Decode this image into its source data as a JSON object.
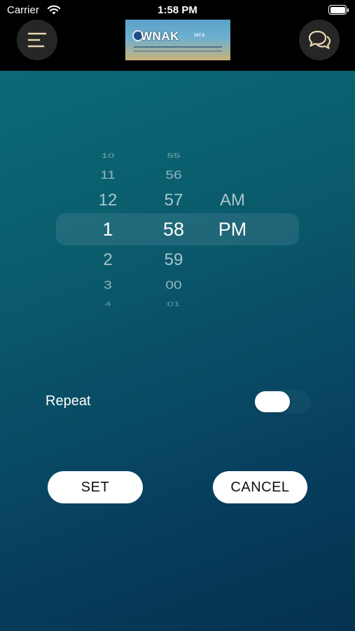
{
  "status_bar": {
    "carrier": "Carrier",
    "time": "1:58 PM"
  },
  "header": {
    "logo_text": "WNAK",
    "logo_sub": "107.5",
    "menu_icon": "menu-icon",
    "chat_icon": "chat-icon"
  },
  "picker": {
    "hours": [
      "10",
      "11",
      "12",
      "1",
      "2",
      "3",
      "4"
    ],
    "minutes": [
      "55",
      "56",
      "57",
      "58",
      "59",
      "00",
      "01"
    ],
    "periods": [
      "AM",
      "PM"
    ],
    "selected": {
      "hour": "1",
      "minute": "58",
      "period": "PM"
    }
  },
  "repeat": {
    "label": "Repeat",
    "enabled": false
  },
  "buttons": {
    "set": "SET",
    "cancel": "CANCEL"
  },
  "colors": {
    "background_top": "#0b6f78",
    "background_bottom": "#05324f",
    "header_bg": "#000000",
    "icon_accent": "#e8d5b0"
  }
}
